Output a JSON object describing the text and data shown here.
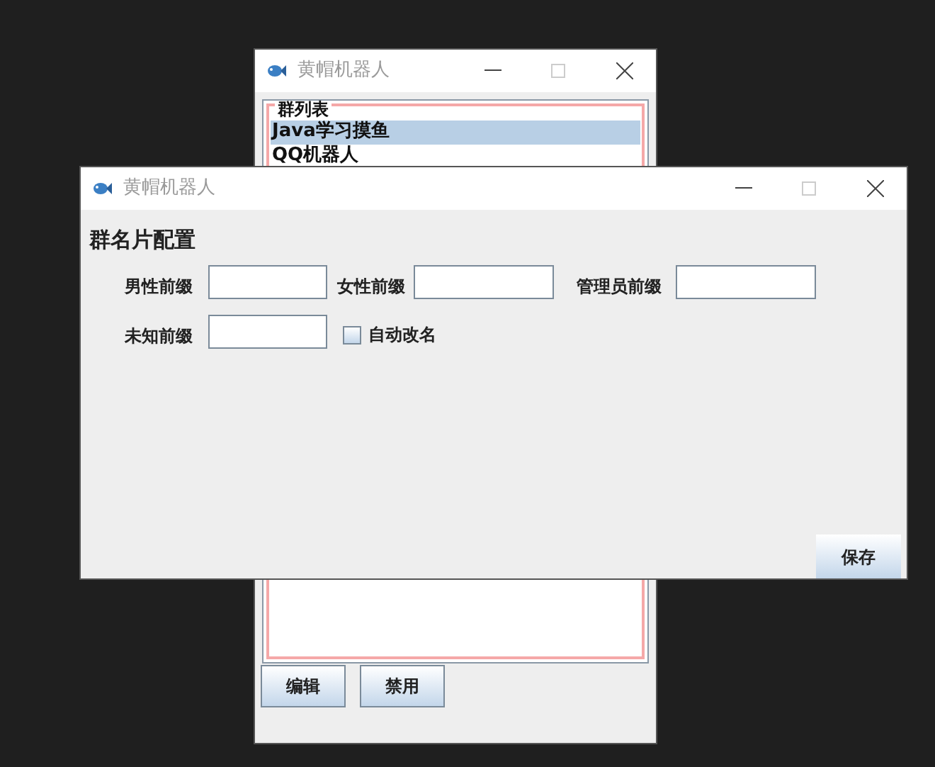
{
  "back_window": {
    "title": "黄帽机器人",
    "group_list": {
      "title": "群列表",
      "items": [
        {
          "label": "Java学习摸鱼",
          "selected": true
        },
        {
          "label": "QQ机器人",
          "selected": false
        }
      ]
    },
    "buttons": [
      "编辑",
      "禁用"
    ]
  },
  "front_window": {
    "title": "黄帽机器人",
    "heading": "群名片配置",
    "fields": [
      {
        "label": "男性前缀"
      },
      {
        "label": "女性前缀"
      },
      {
        "label": "管理员前缀"
      },
      {
        "label": "未知前缀"
      }
    ],
    "auto_rename": {
      "label": "自动改名",
      "checked": false
    },
    "save_button": "保存"
  }
}
